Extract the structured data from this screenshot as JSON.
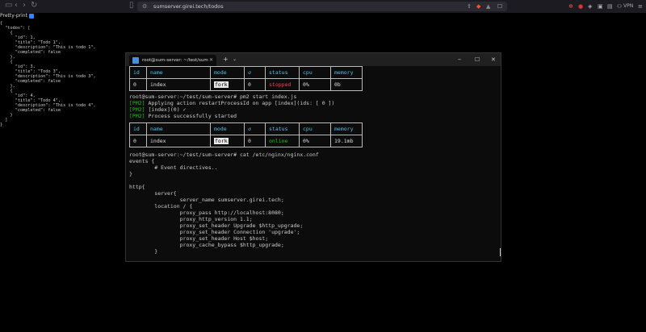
{
  "browser": {
    "url": "sumserver.girei.tech/todos",
    "vpn_label": "VPN"
  },
  "pretty_print_label": "Pretty-print",
  "json_text": "{\n  \"todos\": [\n    {\n      \"id\": 1,\n      \"title\": \"Todo 1\",\n      \"description\": \"This is todo 1\",\n      \"completed\": false\n    },\n    {\n      \"id\": 3,\n      \"title\": \"Todo 3\",\n      \"description\": \"This is todo 3\",\n      \"completed\": false\n    },\n    {\n      \"id\": 4,\n      \"title\": \"Todo 4\",\n      \"description\": \"This is todo 4\",\n      \"completed\": false\n    }\n  ]\n}",
  "terminal": {
    "tab_title": "root@sum-server: ~/test/sum",
    "table_headers": [
      "id",
      "name",
      "mode",
      "↺",
      "status",
      "cpu",
      "memory"
    ],
    "table1_row": [
      "0",
      "index",
      "fork",
      "0",
      "stopped",
      "0%",
      "0b"
    ],
    "table2_row": [
      "0",
      "index",
      "fork",
      "0",
      "online",
      "0%",
      "19.1mb"
    ],
    "prompt1": "root@sum-server:~/test/sum-server# pm2 start index.js",
    "pm2_tag": "[PM2]",
    "pm2_line1": " Applying action restartProcessId on app [index](ids: [ 0 ])",
    "pm2_line2": " [index](0) ✓",
    "pm2_line3": " Process successfully started",
    "prompt2": "root@sum-server:~/test/sum-server# cat /etc/nginx/nginx.conf",
    "conf_lines": [
      "events {",
      "        # Event directives..",
      "}",
      "",
      "http{",
      "        server{",
      "                server_name sumserver.girei.tech;",
      "        location / {",
      "                proxy_pass http://localhost:8080;",
      "                proxy_http_version 1.1;",
      "                proxy_set_header Upgrade $http_upgrade;",
      "                proxy_set_header Connection 'upgrade';",
      "                proxy_set_header Host $host;",
      "                proxy_cache_bypass $http_upgrade;",
      "        }"
    ]
  }
}
